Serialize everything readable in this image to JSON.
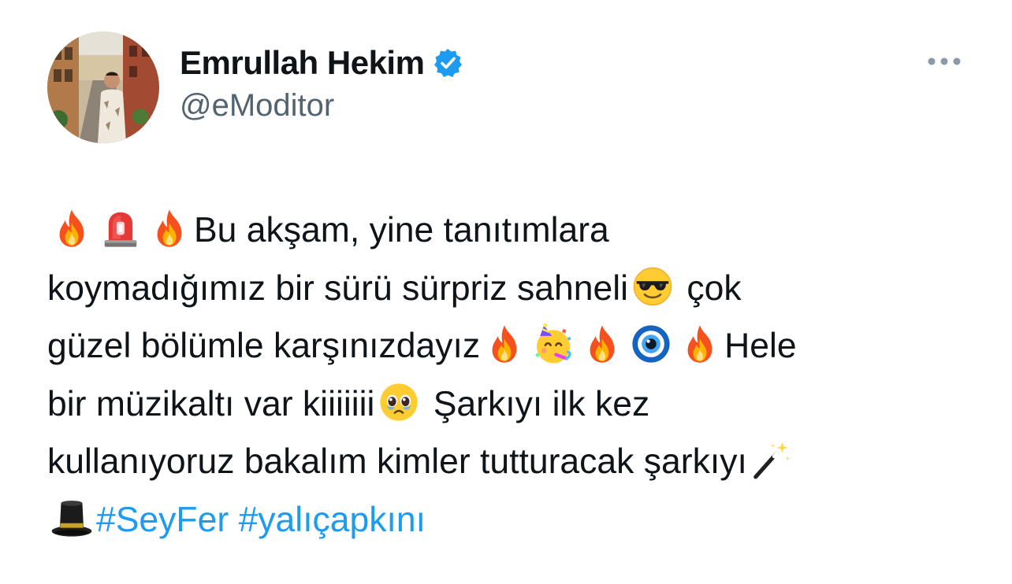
{
  "tweet": {
    "author": {
      "display_name": "Emrullah Hekim",
      "handle": "@eModitor",
      "verified": true,
      "avatar_icon": "profile-photo"
    },
    "more_icon": "more-options-icon",
    "text_segments": {
      "s1": "Bu akşam, yine tanıtımlara",
      "s2": "koymadığımız bir sürü sürpriz sahneli",
      "s3": " çok",
      "s4": "güzel bölümle karşınızdayız",
      "s5": "Hele",
      "s6": "bir müzikaltı var kiiiiiii",
      "s7": " Şarkıyı ilk kez",
      "s8": "kullanıyoruz bakalım kimler tutturacak şarkıyı"
    },
    "hashtags": [
      "#SeyFer",
      "#yalıçapkını"
    ],
    "emojis": {
      "fire": "🔥",
      "siren": "🚨",
      "sunglasses": "😎",
      "party_face": "🥳",
      "evil_eye": "🧿",
      "pleading_face": "🥹",
      "magic_wand": "🪄",
      "top_hat": "🎩"
    },
    "colors": {
      "text": "#0f1419",
      "secondary": "#536471",
      "link": "#1d9bf0",
      "verified": "#1d9bf0"
    }
  }
}
